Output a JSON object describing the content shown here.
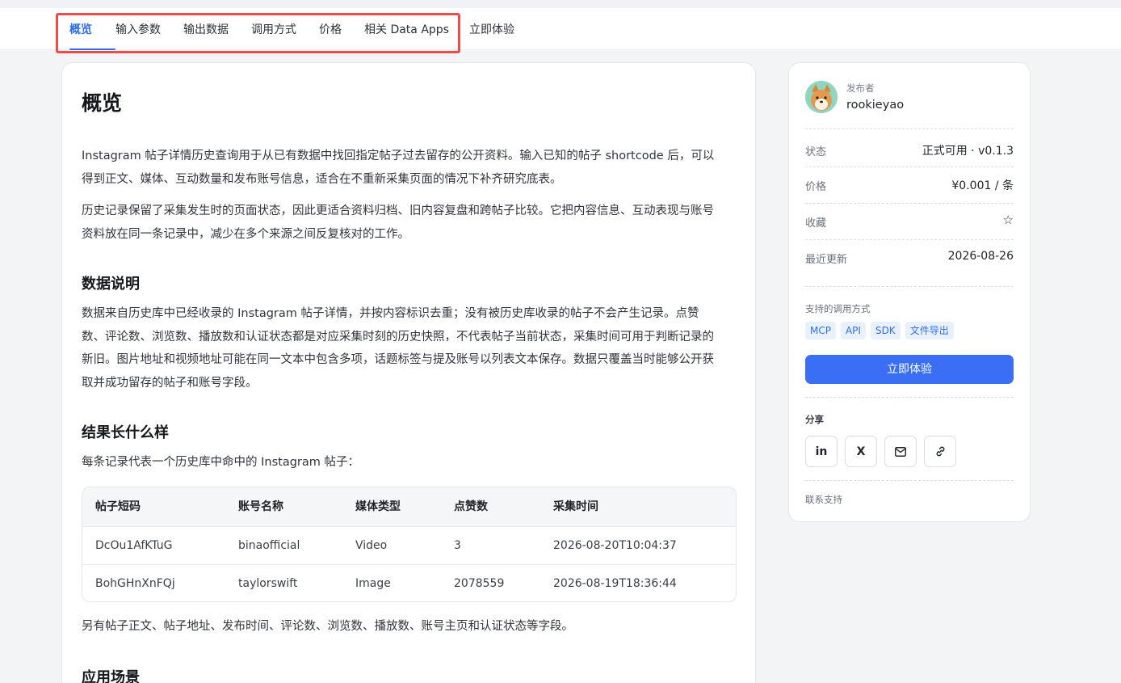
{
  "nav": {
    "tabs": [
      {
        "label": "概览"
      },
      {
        "label": "输入参数"
      },
      {
        "label": "输出数据"
      },
      {
        "label": "调用方式"
      },
      {
        "label": "价格"
      },
      {
        "label": "相关 Data Apps"
      },
      {
        "label": "立即体验"
      }
    ],
    "active_index": 0
  },
  "overview": {
    "title": "概览",
    "para1_line1": "Instagram 帖子详情历史查询用于从已有数据中找回指定帖子过去留存的公开资料。输入已知的帖子 shortcode 后，可以",
    "para1_line2": "得到正文、媒体、互动数量和发布账号信息，适合在不重新采集页面的情况下补齐研究底表。",
    "para2_line1": "历史记录保留了采集发生时的页面状态，因此更适合资料归档、旧内容复盘和跨帖子比较。它把内容信息、互动表现与账号",
    "para2_line2": "资料放在同一条记录中，减少在多个来源之间反复核对的工作。",
    "data_heading": "数据说明",
    "data_line1": "数据来自历史库中已经收录的 Instagram 帖子详情，并按内容标识去重；没有被历史库收录的帖子不会产生记录。点赞",
    "data_line2": "数、评论数、浏览数、播放数和认证状态都是对应采集时刻的历史快照，不代表帖子当前状态，采集时间可用于判断记录的",
    "data_line3": "新旧。图片地址和视频地址可能在同一文本中包含多项，话题标签与提及账号以列表文本保存。数据只覆盖当时能够公开获",
    "data_line4": "取并成功留存的帖子和账号字段。",
    "result_heading": "结果长什么样",
    "result_intro": "每条记录代表一个历史库中命中的 Instagram 帖子：",
    "table": {
      "headers": [
        "帖子短码",
        "账号名称",
        "媒体类型",
        "点赞数",
        "采集时间"
      ],
      "rows": [
        [
          "DcOu1AfKTuG",
          "binaofficial",
          "Video",
          "3",
          "2026-08-20T10:04:37"
        ],
        [
          "BohGHnXnFQj",
          "taylorswift",
          "Image",
          "2078559",
          "2026-08-19T18:36:44"
        ]
      ]
    },
    "after_table": "另有帖子正文、帖子地址、发布时间、评论数、浏览数、播放数、账号主页和认证状态等字段。",
    "usage_heading": "应用场景"
  },
  "sidebar": {
    "publisher_label": "发布者",
    "publisher_name": "rookieyao",
    "status_label": "状态",
    "status_value": "正式可用 · v0.1.3",
    "price_label": "价格",
    "price_value": "¥0.001 / 条",
    "favorite_label": "收藏",
    "favorite_icon": "☆",
    "updated_label": "最近更新",
    "updated_value": "2026-08-26",
    "methods_label": "支持的调用方式",
    "methods": [
      "MCP",
      "API",
      "SDK",
      "文件导出"
    ],
    "cta_label": "立即体验",
    "share_label": "分享",
    "share": {
      "linkedin": "in",
      "x": "X"
    },
    "support_label": "联系支持"
  },
  "colors": {
    "accent": "#2f6fe4",
    "cta": "#3a6ff5",
    "highlight_box": "#ee4b4b"
  }
}
